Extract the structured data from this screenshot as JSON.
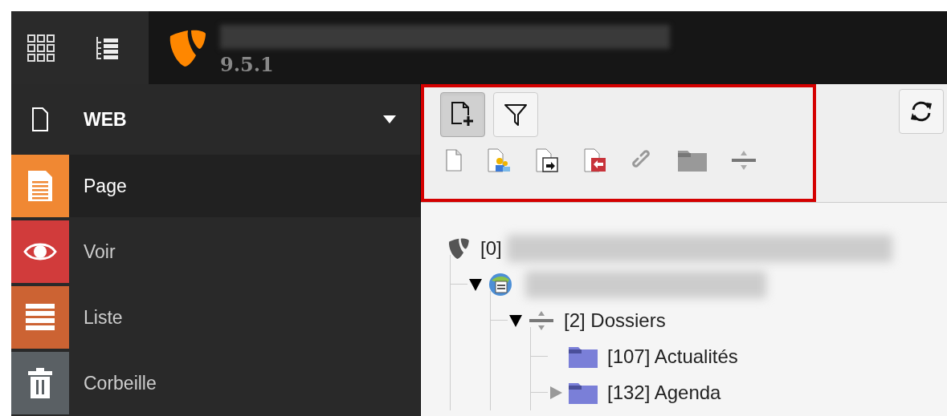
{
  "topbar": {
    "version": "9.5.1"
  },
  "sidebar": {
    "group": {
      "label": "WEB",
      "expanded": true
    },
    "modules": [
      {
        "kind": "page",
        "label": "Page",
        "selected": true,
        "color": "#f08833"
      },
      {
        "kind": "view",
        "label": "Voir",
        "selected": false,
        "color": "#d13b3b"
      },
      {
        "kind": "list",
        "label": "Liste",
        "selected": false,
        "color": "#cc6333"
      },
      {
        "kind": "recycler",
        "label": "Corbeille",
        "selected": false,
        "color": "#5a6064"
      }
    ]
  },
  "toolbar": {
    "new_page_pressed": true,
    "filter_pressed": false
  },
  "tree": [
    {
      "kind": "root",
      "label": "[0]",
      "children": [
        {
          "kind": "site",
          "expanded": true,
          "children": [
            {
              "kind": "separator",
              "label": "[2] Dossiers",
              "expanded": true,
              "children": [
                {
                  "kind": "folder",
                  "label": "[107] Actualités"
                },
                {
                  "kind": "folder",
                  "label": "[132] Agenda",
                  "expanded": false
                }
              ]
            }
          ]
        }
      ]
    }
  ]
}
